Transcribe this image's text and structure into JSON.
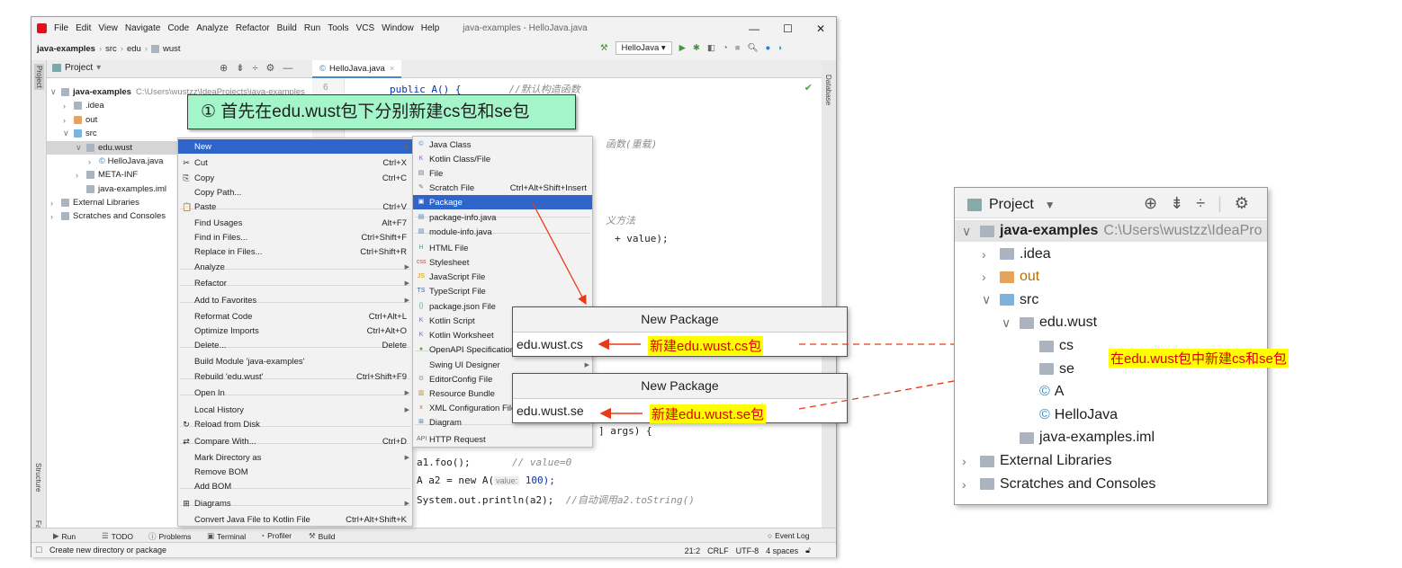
{
  "window": {
    "title": "java-examples - HelloJava.java",
    "menu": [
      "File",
      "Edit",
      "View",
      "Navigate",
      "Code",
      "Analyze",
      "Refactor",
      "Build",
      "Run",
      "Tools",
      "VCS",
      "Window",
      "Help"
    ]
  },
  "breadcrumb": [
    "java-examples",
    "src",
    "edu",
    "wust"
  ],
  "toolbar": {
    "run_config": "HelloJava"
  },
  "project_panel": {
    "title": "Project",
    "tree": [
      {
        "label": "java-examples",
        "path": "C:\\Users\\wustzz\\IdeaProjects\\java-examples",
        "bold": true
      },
      {
        "label": ".idea"
      },
      {
        "label": "out"
      },
      {
        "label": "src"
      },
      {
        "label": "edu.wust"
      },
      {
        "label": "HelloJava.java"
      },
      {
        "label": "META-INF"
      },
      {
        "label": "java-examples.iml"
      },
      {
        "label": "External Libraries"
      },
      {
        "label": "Scratches and Consoles"
      }
    ]
  },
  "editor": {
    "tab": "HelloJava.java",
    "line_number": "6",
    "lines": [
      {
        "code": "public A() {",
        "comment": "//默认构造函数"
      },
      {
        "code": "",
        "comment": "函数(重载)"
      },
      {
        "code": "",
        "comment": "义方法"
      },
      {
        "code": "+ value);",
        "comment": ""
      },
      {
        "code": "] args) {",
        "comment": ""
      },
      {
        "code": "a1.foo();",
        "comment": "// value=0"
      },
      {
        "code": "A a2 = new A(",
        "hint": "value:",
        "arg": "100);"
      },
      {
        "code": "System.out.println(a2);",
        "comment": "//自动调用a2.toString()"
      }
    ]
  },
  "context_menu": [
    {
      "label": "New",
      "sub": true,
      "selected": true
    },
    {
      "label": "Cut",
      "shortcut": "Ctrl+X",
      "icon": "✂"
    },
    {
      "label": "Copy",
      "shortcut": "Ctrl+C",
      "icon": "⎘"
    },
    {
      "label": "Copy Path..."
    },
    {
      "label": "Paste",
      "shortcut": "Ctrl+V",
      "icon": "📋"
    },
    {
      "label": "Find Usages",
      "shortcut": "Alt+F7"
    },
    {
      "label": "Find in Files...",
      "shortcut": "Ctrl+Shift+F"
    },
    {
      "label": "Replace in Files...",
      "shortcut": "Ctrl+Shift+R"
    },
    {
      "label": "Analyze",
      "sub": true
    },
    {
      "label": "Refactor",
      "sub": true
    },
    {
      "label": "Add to Favorites",
      "sub": true
    },
    {
      "label": "Reformat Code",
      "shortcut": "Ctrl+Alt+L"
    },
    {
      "label": "Optimize Imports",
      "shortcut": "Ctrl+Alt+O"
    },
    {
      "label": "Delete...",
      "shortcut": "Delete"
    },
    {
      "label": "Build Module 'java-examples'"
    },
    {
      "label": "Rebuild 'edu.wust'",
      "shortcut": "Ctrl+Shift+F9"
    },
    {
      "label": "Open In",
      "sub": true
    },
    {
      "label": "Local History",
      "sub": true
    },
    {
      "label": "Reload from Disk",
      "icon": "↻"
    },
    {
      "label": "Compare With...",
      "shortcut": "Ctrl+D",
      "icon": "⇄"
    },
    {
      "label": "Mark Directory as",
      "sub": true
    },
    {
      "label": "Remove BOM"
    },
    {
      "label": "Add BOM"
    },
    {
      "label": "Diagrams",
      "sub": true,
      "icon": "⊞"
    },
    {
      "label": "Convert Java File to Kotlin File",
      "shortcut": "Ctrl+Alt+Shift+K"
    }
  ],
  "new_submenu": [
    {
      "label": "Java Class"
    },
    {
      "label": "Kotlin Class/File"
    },
    {
      "label": "File"
    },
    {
      "label": "Scratch File",
      "shortcut": "Ctrl+Alt+Shift+Insert"
    },
    {
      "label": "Package",
      "selected": true
    },
    {
      "label": "package-info.java"
    },
    {
      "label": "module-info.java"
    },
    {
      "label": "HTML File"
    },
    {
      "label": "Stylesheet"
    },
    {
      "label": "JavaScript File"
    },
    {
      "label": "TypeScript File"
    },
    {
      "label": "package.json File"
    },
    {
      "label": "Kotlin Script"
    },
    {
      "label": "Kotlin Worksheet"
    },
    {
      "label": "OpenAPI Specification"
    },
    {
      "label": "Swing UI Designer",
      "sub": true
    },
    {
      "label": "EditorConfig File"
    },
    {
      "label": "Resource Bundle"
    },
    {
      "label": "XML Configuration File"
    },
    {
      "label": "Diagram"
    },
    {
      "label": "HTTP Request"
    }
  ],
  "dialogs": [
    {
      "title": "New Package",
      "value": "edu.wust.cs",
      "annotation": "新建edu.wust.cs包"
    },
    {
      "title": "New Package",
      "value": "edu.wust.se",
      "annotation": "新建edu.wust.se包"
    }
  ],
  "banner": "① 首先在edu.wust包下分别新建cs包和se包",
  "bottom_tools": [
    "Run",
    "TODO",
    "Problems",
    "Terminal",
    "Profiler",
    "Build",
    "Event Log"
  ],
  "status": {
    "message": "Create new directory or package",
    "position": "21:2",
    "line_sep": "CRLF",
    "encoding": "UTF-8",
    "indent": "4 spaces"
  },
  "side_tabs": {
    "left": [
      "Project",
      "Structure",
      "Favorites"
    ],
    "right": [
      "Database"
    ]
  },
  "result_panel": {
    "title": "Project",
    "tree": [
      {
        "label": "java-examples",
        "path": "C:\\Users\\wustzz\\IdeaPro"
      },
      {
        "label": ".idea"
      },
      {
        "label": "out"
      },
      {
        "label": "src"
      },
      {
        "label": "edu.wust"
      },
      {
        "label": "cs"
      },
      {
        "label": "se"
      },
      {
        "label": "A"
      },
      {
        "label": "HelloJava"
      },
      {
        "label": "java-examples.iml"
      },
      {
        "label": "External Libraries"
      },
      {
        "label": "Scratches and Consoles"
      }
    ],
    "annotation": "在edu.wust包中新建cs和se包"
  },
  "colors": {
    "selection": "#2f65ca",
    "banner": "#a5f5cb",
    "annotation_red": "#e83a17",
    "highlight_yellow": "#ffff00"
  }
}
